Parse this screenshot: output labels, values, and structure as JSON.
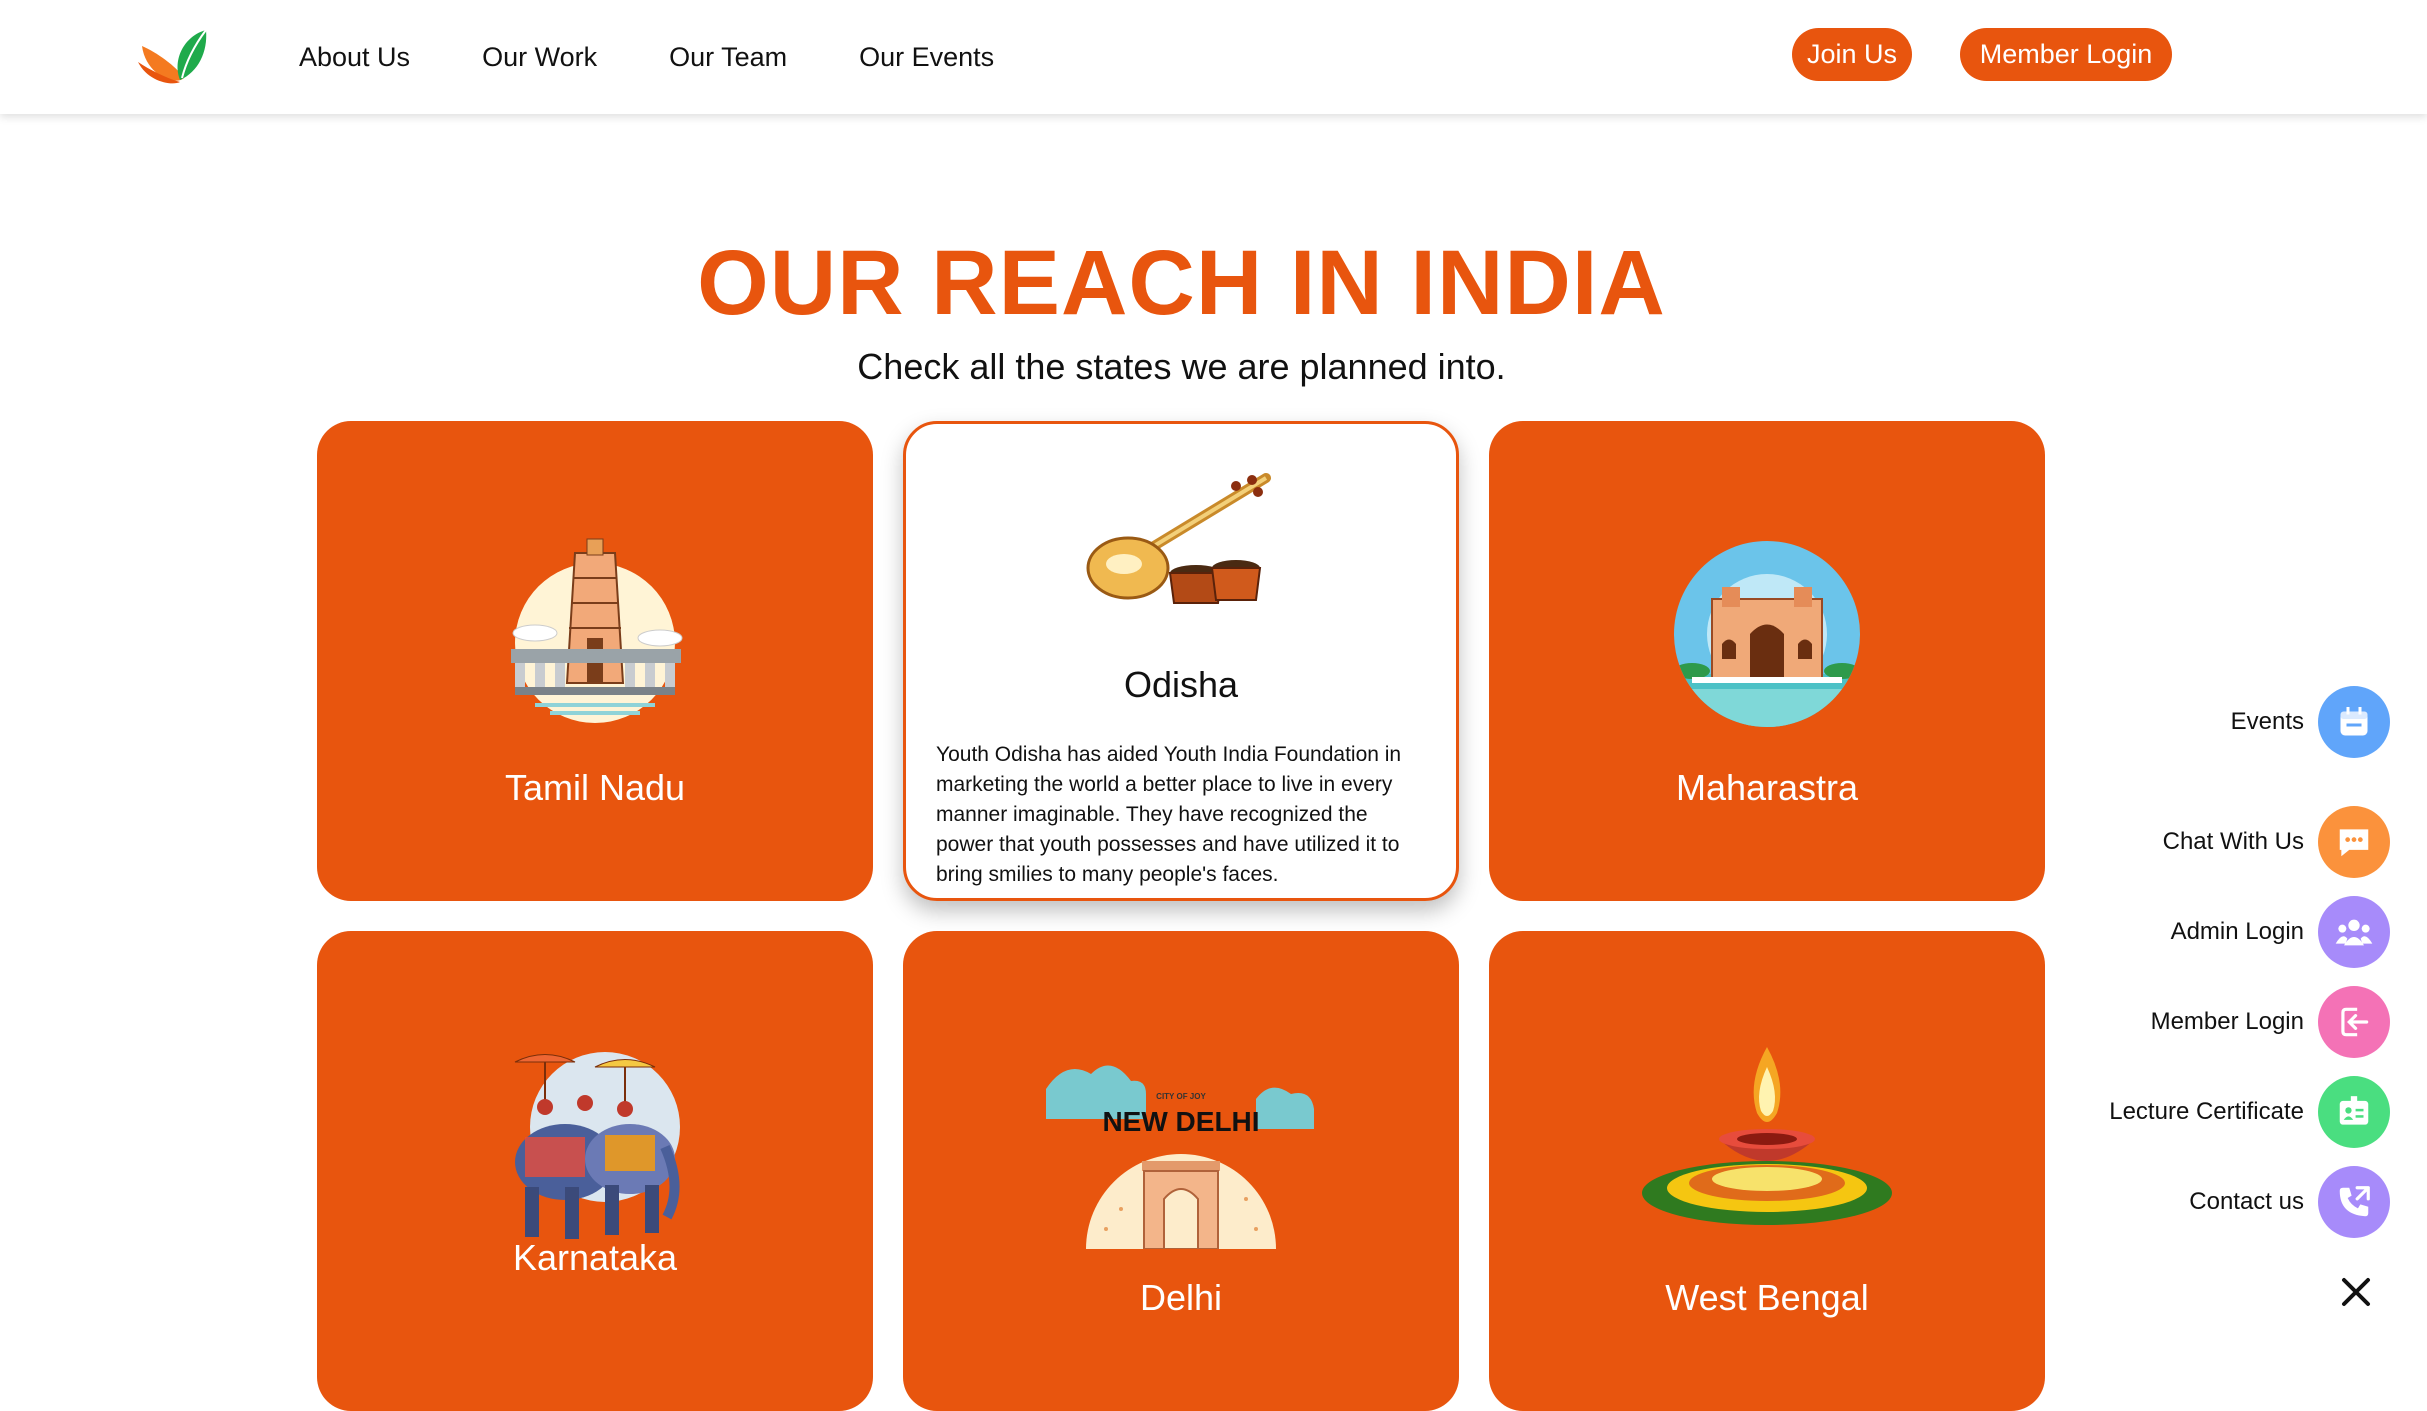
{
  "nav": {
    "links": [
      "About Us",
      "Our Work",
      "Our Team",
      "Our Events"
    ],
    "join_label": "Join Us",
    "member_login_label": "Member Login"
  },
  "hero": {
    "title": "OUR REACH IN INDIA",
    "subtitle": "Check all the states we are planned into."
  },
  "states": [
    {
      "name": "Tamil Nadu",
      "icon": "temple-icon"
    },
    {
      "name": "Odisha",
      "icon": "sitar-tabla-icon",
      "description": "Youth Odisha has aided Youth India Foundation in marketing the world a better place to live in every manner imaginable. They have recognized the power that youth possesses and have utilized it to bring smilies to many people's faces."
    },
    {
      "name": "Maharastra",
      "icon": "gateway-of-india-icon"
    },
    {
      "name": "Karnataka",
      "icon": "elephant-procession-icon"
    },
    {
      "name": "Delhi",
      "icon": "india-gate-icon",
      "banner_small": "CITY OF JOY",
      "banner_big": "NEW DELHI"
    },
    {
      "name": "West Bengal",
      "icon": "diya-lamp-icon"
    }
  ],
  "floating_menu": [
    {
      "label": "Events",
      "color": "#60a5fa",
      "icon": "calendar-icon"
    },
    {
      "label": "Chat With Us",
      "color": "#fb923c",
      "icon": "chat-icon"
    },
    {
      "label": "Admin Login",
      "color": "#a78bfa",
      "icon": "group-icon"
    },
    {
      "label": "Member Login",
      "color": "#f472b6",
      "icon": "login-icon"
    },
    {
      "label": "Lecture Certificate",
      "color": "#4ade80",
      "icon": "certificate-icon"
    },
    {
      "label": "Contact us",
      "color": "#a78bfa",
      "icon": "phone-icon"
    }
  ],
  "colors": {
    "accent": "#e8550e",
    "logo_orange": "#f47a20",
    "logo_green": "#1faa4b"
  }
}
